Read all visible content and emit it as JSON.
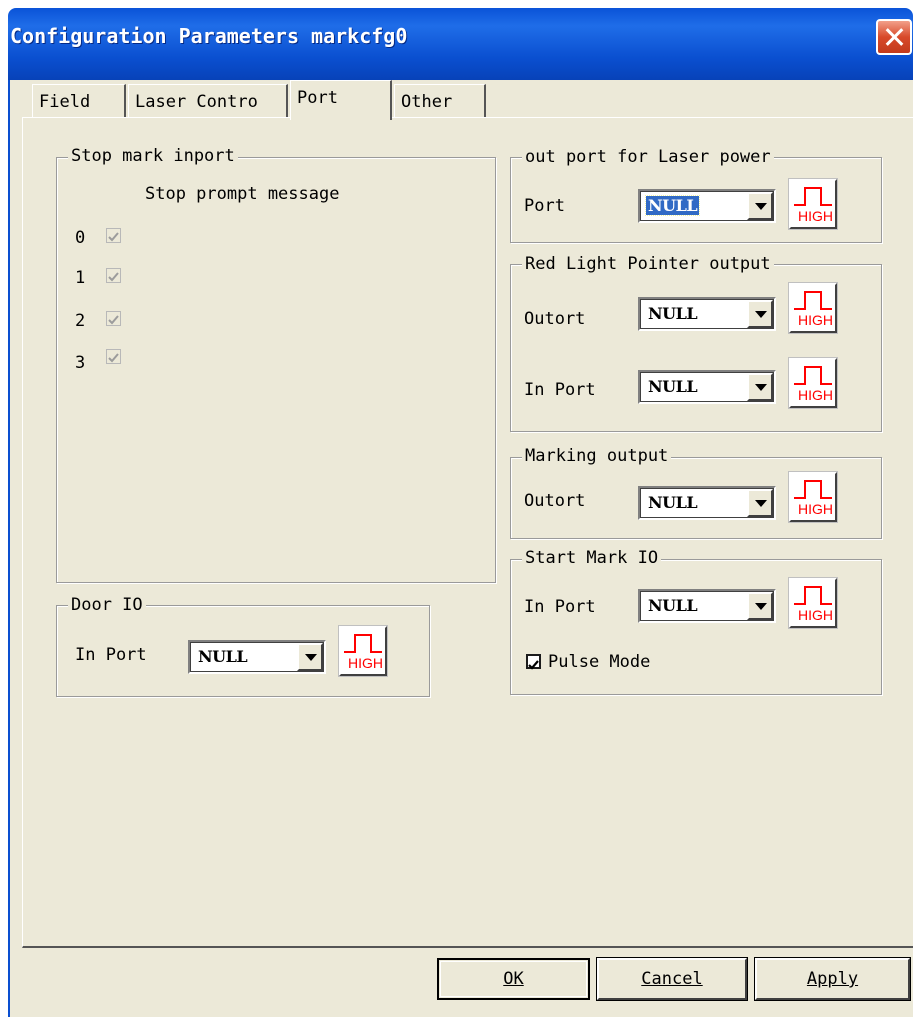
{
  "window": {
    "title": "Configuration Parameters markcfg0"
  },
  "tabs": [
    {
      "label": "Field"
    },
    {
      "label": "Laser Contro"
    },
    {
      "label": "Port",
      "active": true
    },
    {
      "label": "Other"
    }
  ],
  "stop_mark": {
    "legend": "Stop mark inport",
    "prompt_header": "Stop prompt message",
    "rows": [
      {
        "index": "0",
        "checked": true,
        "enabled": false
      },
      {
        "index": "1",
        "checked": true,
        "enabled": false
      },
      {
        "index": "2",
        "checked": true,
        "enabled": false
      },
      {
        "index": "3",
        "checked": true,
        "enabled": false
      }
    ]
  },
  "door_io": {
    "legend": "Door IO",
    "in_port_label": "In Port",
    "in_port_value": "NULL"
  },
  "laser_power": {
    "legend": "out port for Laser power",
    "port_label": "Port",
    "port_value": "NULL"
  },
  "red_light": {
    "legend": "Red Light Pointer output",
    "out_port_label": "Outort",
    "out_port_value": "NULL",
    "in_port_label": "In Port",
    "in_port_value": "NULL"
  },
  "marking_output": {
    "legend": "Marking output",
    "out_port_label": "Outort",
    "out_port_value": "NULL"
  },
  "start_mark": {
    "legend": "Start Mark IO",
    "in_port_label": "In Port",
    "in_port_value": "NULL",
    "pulse_mode_label": "Pulse Mode",
    "pulse_mode_checked": true
  },
  "level_button_label": "HIGH",
  "buttons": {
    "ok": "OK",
    "cancel": "Cancel",
    "apply": "Apply"
  },
  "colors": {
    "title_bar": "#0a53d8",
    "dialog_bg": "#ece9d8",
    "high_signal": "#ff0000",
    "selection": "#316ac5"
  },
  "icons": {
    "close": "close-icon",
    "dropdown": "chevron-down-icon",
    "level": "pulse-high-icon"
  }
}
